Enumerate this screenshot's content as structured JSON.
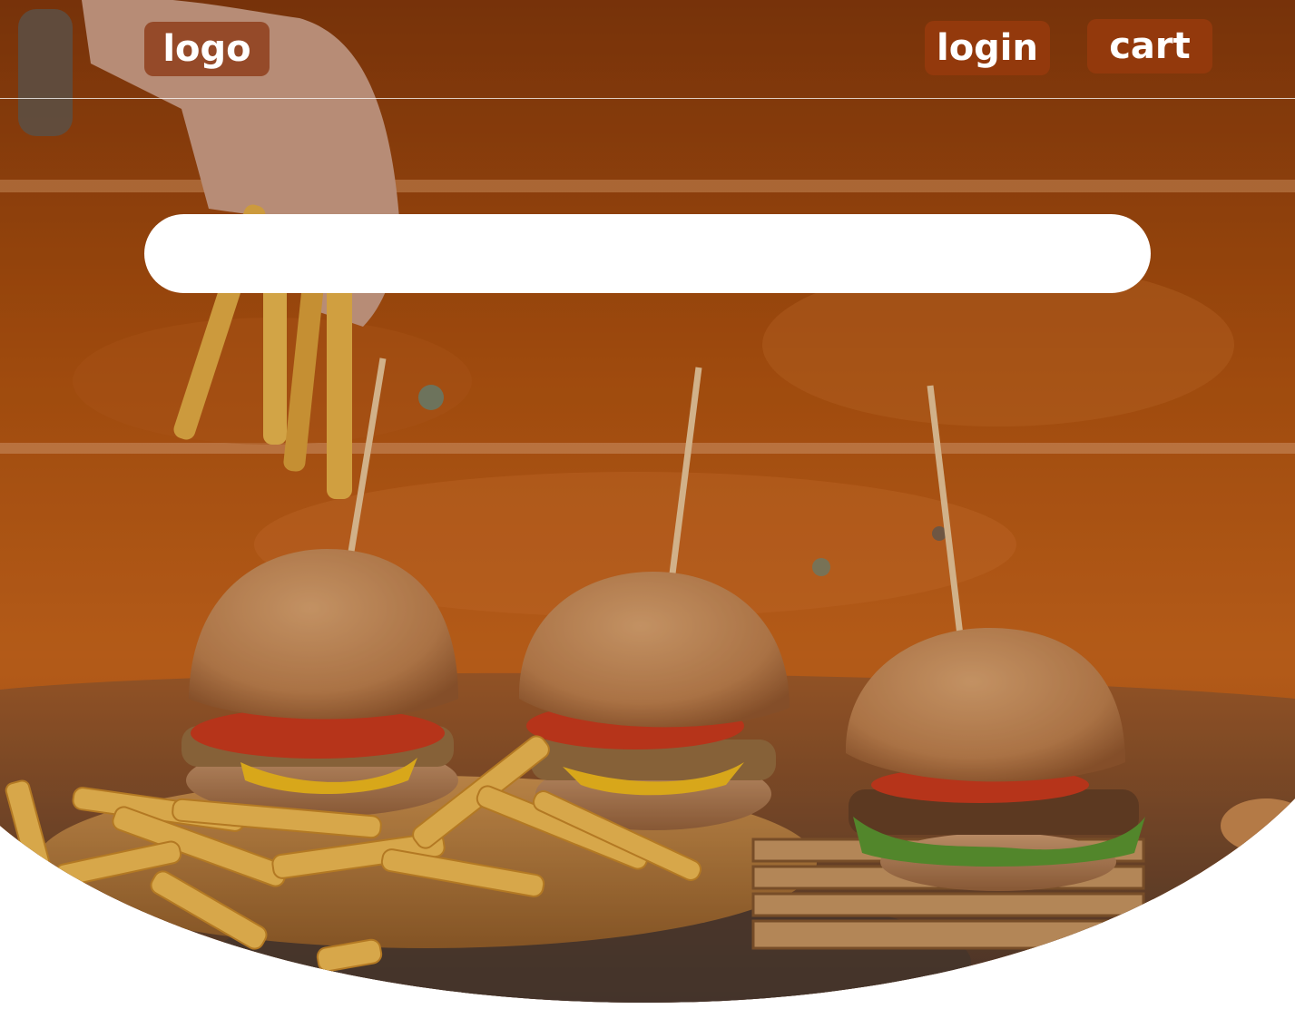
{
  "header": {
    "logo_label": "logo",
    "login_label": "login",
    "cart_label": "cart"
  },
  "search": {
    "value": "",
    "placeholder": ""
  },
  "hero": {
    "subject": "burgers-and-fries-photo",
    "overlay_color": "#b5520f"
  },
  "colors": {
    "button_bg": "#963a0c",
    "button_text": "#ffffff",
    "search_bg": "#ffffff",
    "page_bg": "#ffffff"
  }
}
